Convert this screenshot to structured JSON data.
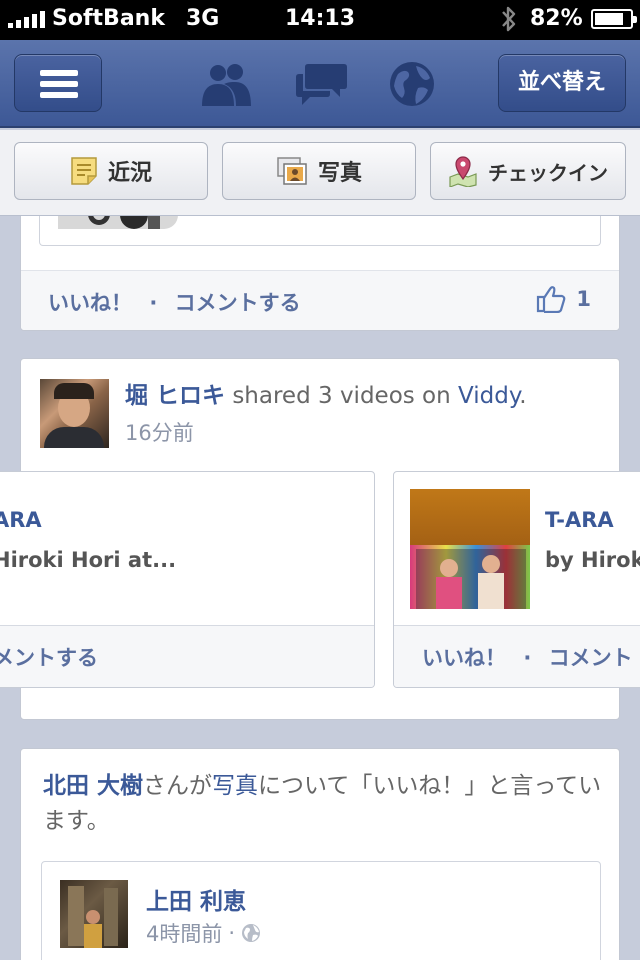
{
  "status": {
    "carrier": "SoftBank",
    "network": "3G",
    "time": "14:13",
    "battery": "82%",
    "battery_level": 0.82
  },
  "navbar": {
    "sort_label": "並べ替え"
  },
  "publisher": {
    "status_label": "近況",
    "photo_label": "写真",
    "checkin_label": "チェックイン"
  },
  "post1": {
    "like_label": "いいね！",
    "separator": "·",
    "comment_label": "コメントする",
    "like_count": "1"
  },
  "post2": {
    "author": "堀 ヒロキ",
    "action_text": "shared 3 videos on",
    "app_name": "Viddy",
    "period": ".",
    "time": "16分前",
    "videos": [
      {
        "title": "ARA",
        "subtitle": "Hiroki Hori at...",
        "comment_label": "メントする"
      },
      {
        "title": "T-ARA",
        "subtitle": "by Hirok",
        "like_label": "いいね！",
        "separator": "·",
        "comment_label": "コメント"
      }
    ]
  },
  "post3": {
    "actor": "北田 大樹",
    "text_before": "さんが",
    "link": "写真",
    "text_after": "について「いいね！」と言っています。",
    "shared_author": "上田 利恵",
    "shared_time": "4時間前",
    "shared_separator": "·"
  },
  "colors": {
    "nav": "#3d5896",
    "link": "#3b5998",
    "background": "#c6ccdb"
  }
}
